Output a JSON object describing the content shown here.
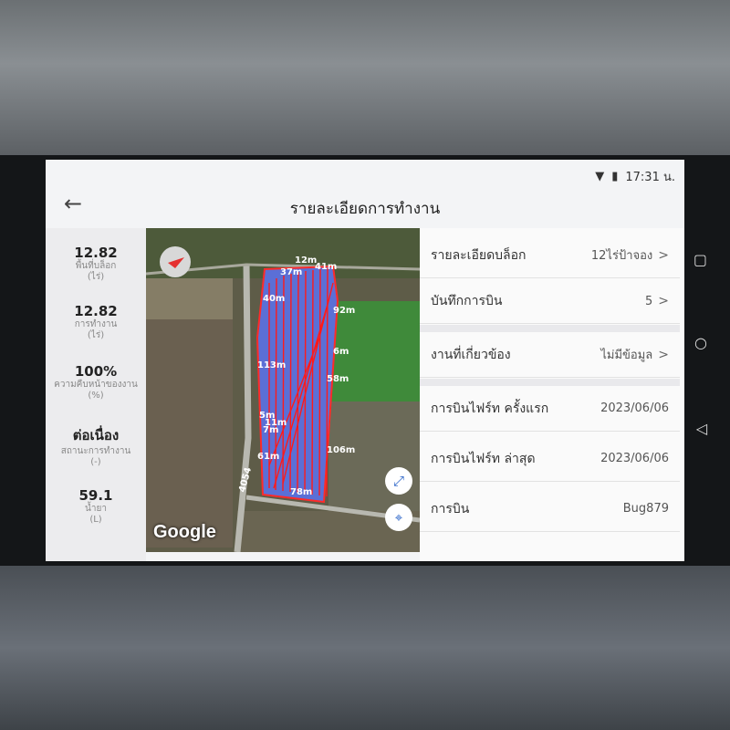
{
  "status": {
    "time": "17:31 น."
  },
  "header": {
    "title": "รายละเอียดการทำงาน"
  },
  "stats": [
    {
      "value": "12.82",
      "label_1": "พื้นที่บล็อก",
      "label_2": "(ไร่)"
    },
    {
      "value": "12.82",
      "label_1": "การทำงาน",
      "label_2": "(ไร่)"
    },
    {
      "value": "100%",
      "label_1": "ความคืบหน้าของงาน",
      "label_2": "(%)"
    },
    {
      "value": "ต่อเนื่อง",
      "label_1": "สถานะการทำงาน",
      "label_2": "(-)"
    },
    {
      "value": "59.1",
      "label_1": "น้ำยา",
      "label_2": "(L)"
    }
  ],
  "map": {
    "attribution": "Google",
    "road_label": "4054",
    "distances": [
      "12m",
      "37m",
      "41m",
      "40m",
      "92m",
      "6m",
      "113m",
      "58m",
      "5m",
      "11m",
      "7m",
      "61m",
      "106m",
      "78m"
    ]
  },
  "details": [
    {
      "label": "รายละเอียดบล็อก",
      "value": "12ไร่ป้าจอง"
    },
    {
      "label": "บันทึกการบิน",
      "value": "5"
    },
    {
      "label": "งานที่เกี่ยวข้อง",
      "value": "ไม่มีข้อมูล"
    },
    {
      "label": "การบินไฟร์ท ครั้งแรก",
      "value": "2023/06/06"
    },
    {
      "label": "การบินไฟร์ท ล่าสุด",
      "value": "2023/06/06"
    },
    {
      "label": "การบิน",
      "value": "Bug879"
    }
  ],
  "colors": {
    "field_fill": "#5b6fd6",
    "flight_path": "#ff1a1a",
    "boundary": "#ff2a2a"
  }
}
